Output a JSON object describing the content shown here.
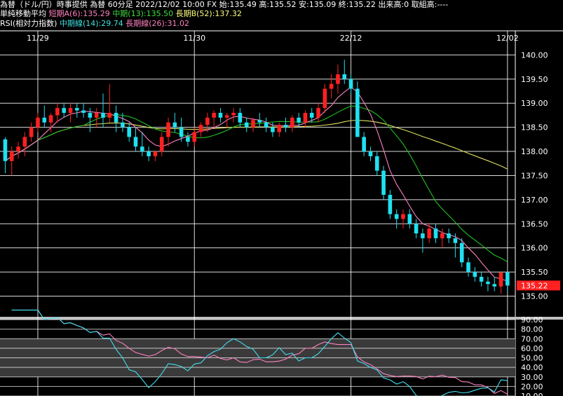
{
  "header": {
    "line1": "為替（ドル/円）時事提供 為替 60分足 2022/12/02 10:00 FX 始:135.49 高:135.52 安:135.09 終:135.22 出来高:0 取組高:----",
    "ma_label": "単純移動平均",
    "ma_short": "短期A(6):135.29",
    "ma_mid": "中期(13):135.50",
    "ma_long": "長期B(52):137.32",
    "rsi_label": "RSI(相対力指数)",
    "rsi_mid": "中期線(14):29.74",
    "rsi_long": "長期線(26):31.02"
  },
  "colors": {
    "up": "#ff2020",
    "down": "#20e0f0",
    "ma_short": "#ff80c0",
    "ma_mid": "#20c020",
    "ma_long": "#e0e060",
    "rsi_mid": "#40e0f0",
    "rsi_long": "#ff80c0",
    "price_tag": "#ff2020"
  },
  "chart_data": [
    {
      "type": "candlestick",
      "x_ticks": [
        {
          "label": "11/29",
          "index": 5
        },
        {
          "label": "11/30",
          "index": 29
        },
        {
          "label": "22/12",
          "index": 53
        },
        {
          "label": "12/02",
          "index": 77
        }
      ],
      "ylim": [
        134.6,
        140.5
      ],
      "y_ticks": [
        {
          "label": "135.00",
          "value": 135.0
        },
        {
          "label": "135.50",
          "value": 135.5
        },
        {
          "label": "136.00",
          "value": 136.0
        },
        {
          "label": "136.50",
          "value": 136.5
        },
        {
          "label": "137.00",
          "value": 137.0
        },
        {
          "label": "137.50",
          "value": 137.5
        },
        {
          "label": "138.00",
          "value": 138.0
        },
        {
          "label": "138.50",
          "value": 138.5
        },
        {
          "label": "139.00",
          "value": 139.0
        },
        {
          "label": "139.50",
          "value": 139.5
        },
        {
          "label": "140.00",
          "value": 140.0
        }
      ],
      "last_price_label": "135.22",
      "last_price": 135.22,
      "ohlc": [
        [
          138.25,
          138.3,
          137.55,
          137.8
        ],
        [
          137.8,
          138.1,
          137.5,
          138.0
        ],
        [
          138.0,
          138.2,
          137.85,
          138.1
        ],
        [
          138.1,
          138.4,
          137.9,
          138.3
        ],
        [
          138.3,
          138.6,
          138.2,
          138.5
        ],
        [
          138.5,
          138.8,
          138.4,
          138.7
        ],
        [
          138.7,
          138.95,
          138.5,
          138.6
        ],
        [
          138.6,
          138.8,
          138.4,
          138.75
        ],
        [
          138.75,
          139.0,
          138.6,
          138.9
        ],
        [
          138.9,
          139.0,
          138.7,
          138.8
        ],
        [
          138.8,
          139.0,
          138.6,
          138.9
        ],
        [
          138.9,
          139.0,
          138.7,
          138.85
        ],
        [
          138.85,
          139.0,
          138.7,
          138.8
        ],
        [
          138.8,
          138.9,
          138.4,
          138.7
        ],
        [
          138.7,
          138.9,
          138.5,
          138.8
        ],
        [
          138.8,
          139.2,
          138.5,
          138.7
        ],
        [
          138.7,
          139.4,
          138.6,
          138.8
        ],
        [
          138.8,
          138.95,
          138.4,
          138.6
        ],
        [
          138.6,
          138.8,
          138.4,
          138.5
        ],
        [
          138.5,
          138.6,
          138.2,
          138.3
        ],
        [
          138.3,
          138.5,
          138.0,
          138.1
        ],
        [
          138.1,
          138.4,
          137.9,
          138.0
        ],
        [
          138.0,
          138.1,
          137.8,
          137.9
        ],
        [
          137.9,
          138.0,
          137.8,
          138.0
        ],
        [
          138.0,
          138.4,
          137.9,
          138.3
        ],
        [
          138.3,
          138.7,
          138.1,
          138.6
        ],
        [
          138.6,
          138.8,
          138.4,
          138.5
        ],
        [
          138.5,
          138.7,
          138.2,
          138.3
        ],
        [
          138.3,
          138.4,
          138.1,
          138.2
        ],
        [
          138.2,
          138.5,
          138.1,
          138.4
        ],
        [
          138.4,
          138.6,
          138.3,
          138.55
        ],
        [
          138.55,
          138.8,
          138.4,
          138.7
        ],
        [
          138.7,
          138.85,
          138.5,
          138.8
        ],
        [
          138.8,
          138.9,
          138.6,
          138.7
        ],
        [
          138.7,
          138.8,
          138.5,
          138.75
        ],
        [
          138.75,
          138.9,
          138.6,
          138.8
        ],
        [
          138.8,
          138.9,
          138.5,
          138.6
        ],
        [
          138.6,
          138.7,
          138.4,
          138.5
        ],
        [
          138.5,
          138.7,
          138.4,
          138.65
        ],
        [
          138.65,
          138.8,
          138.5,
          138.6
        ],
        [
          138.6,
          138.7,
          138.4,
          138.5
        ],
        [
          138.5,
          138.6,
          138.3,
          138.4
        ],
        [
          138.4,
          138.6,
          138.3,
          138.55
        ],
        [
          138.55,
          138.7,
          138.4,
          138.5
        ],
        [
          138.5,
          138.75,
          138.4,
          138.7
        ],
        [
          138.7,
          138.8,
          138.5,
          138.6
        ],
        [
          138.6,
          138.85,
          138.5,
          138.8
        ],
        [
          138.8,
          138.9,
          138.6,
          138.7
        ],
        [
          138.7,
          139.0,
          138.6,
          138.9
        ],
        [
          138.9,
          139.4,
          138.8,
          139.3
        ],
        [
          139.3,
          139.6,
          139.1,
          139.4
        ],
        [
          139.4,
          139.8,
          139.2,
          139.6
        ],
        [
          139.6,
          139.9,
          139.4,
          139.5
        ],
        [
          139.5,
          139.6,
          139.2,
          139.3
        ],
        [
          139.3,
          139.45,
          138.3,
          138.3
        ],
        [
          138.3,
          138.4,
          137.9,
          138.0
        ],
        [
          138.0,
          138.1,
          137.8,
          137.9
        ],
        [
          137.9,
          138.0,
          137.5,
          137.6
        ],
        [
          137.6,
          137.7,
          137.0,
          137.1
        ],
        [
          137.1,
          137.2,
          136.6,
          136.7
        ],
        [
          136.7,
          136.8,
          136.4,
          136.6
        ],
        [
          136.6,
          136.8,
          136.4,
          136.7
        ],
        [
          136.7,
          136.8,
          136.4,
          136.5
        ],
        [
          136.5,
          136.6,
          136.2,
          136.3
        ],
        [
          136.3,
          136.4,
          135.9,
          136.2
        ],
        [
          136.2,
          136.5,
          136.1,
          136.4
        ],
        [
          136.4,
          136.5,
          136.1,
          136.2
        ],
        [
          136.2,
          136.4,
          136.0,
          136.3
        ],
        [
          136.3,
          136.4,
          136.1,
          136.2
        ],
        [
          136.2,
          136.3,
          135.8,
          136.1
        ],
        [
          136.1,
          136.2,
          135.6,
          135.7
        ],
        [
          135.7,
          135.8,
          135.4,
          135.5
        ],
        [
          135.5,
          135.6,
          135.3,
          135.4
        ],
        [
          135.4,
          135.5,
          135.2,
          135.3
        ],
        [
          135.3,
          135.4,
          135.1,
          135.25
        ],
        [
          135.25,
          135.4,
          135.1,
          135.2
        ],
        [
          135.2,
          135.5,
          135.05,
          135.49
        ],
        [
          135.49,
          135.52,
          135.09,
          135.22
        ]
      ]
    },
    {
      "type": "line",
      "ylim": [
        10,
        90
      ],
      "y_ticks": [
        {
          "label": "90.00",
          "value": 90
        },
        {
          "label": "80.00",
          "value": 80
        },
        {
          "label": "70.00",
          "value": 70
        },
        {
          "label": "60.00",
          "value": 60
        },
        {
          "label": "50.00",
          "value": 50
        },
        {
          "label": "40.00",
          "value": 40
        },
        {
          "label": "30.00",
          "value": 30
        },
        {
          "label": "20.00",
          "value": 20
        },
        {
          "label": "10.00",
          "value": 10
        }
      ]
    }
  ]
}
